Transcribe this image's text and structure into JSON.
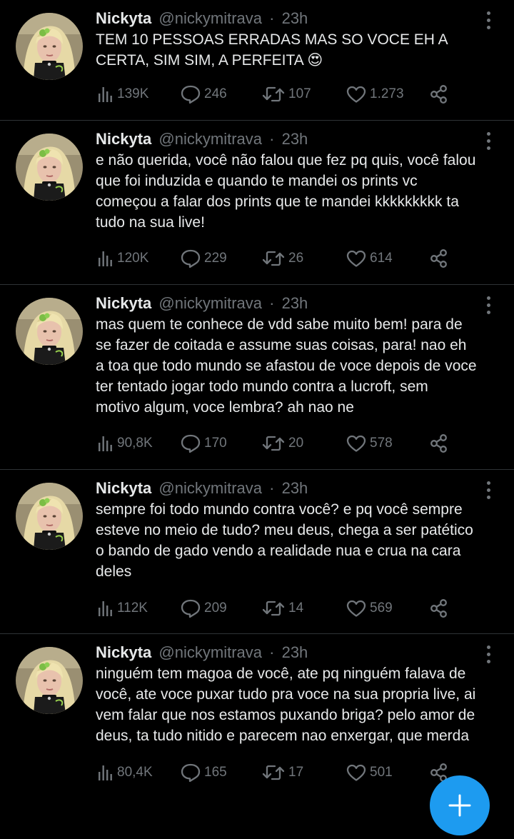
{
  "tweets": [
    {
      "name": "Nickyta",
      "handle": "@nickymitrava",
      "separator": "·",
      "time": "23h",
      "text": "TEM 10 PESSOAS ERRADAS MAS SO VOCE EH A\nCERTA, SIM SIM, A PERFEITA 😍",
      "views": "139K",
      "replies": "246",
      "retweets": "107",
      "likes": "1.273"
    },
    {
      "name": "Nickyta",
      "handle": "@nickymitrava",
      "separator": "·",
      "time": "23h",
      "text": "e não querida, você não falou que fez pq quis, você falou\nque foi induzida e quando te mandei os prints vc\ncomeçou a falar dos prints que te mandei kkkkkkkkk ta\ntudo na sua live!",
      "views": "120K",
      "replies": "229",
      "retweets": "26",
      "likes": "614"
    },
    {
      "name": "Nickyta",
      "handle": "@nickymitrava",
      "separator": "·",
      "time": "23h",
      "text": "mas quem te conhece de vdd sabe muito bem! para de\nse fazer de coitada e assume suas coisas, para! nao eh\na toa que todo mundo se afastou de voce depois de voce\nter tentado jogar todo mundo contra a lucroft, sem\nmotivo algum, voce lembra? ah nao ne",
      "views": "90,8K",
      "replies": "170",
      "retweets": "20",
      "likes": "578"
    },
    {
      "name": "Nickyta",
      "handle": "@nickymitrava",
      "separator": "·",
      "time": "23h",
      "text": "sempre foi todo mundo contra você? e pq você sempre\nesteve no meio de tudo? meu deus, chega a ser patético\no bando de gado vendo a realidade nua e crua na cara\ndeles",
      "views": "112K",
      "replies": "209",
      "retweets": "14",
      "likes": "569"
    },
    {
      "name": "Nickyta",
      "handle": "@nickymitrava",
      "separator": "·",
      "time": "23h",
      "text": "ninguém tem magoa de você, ate pq ninguém falava de\nvocê, ate voce puxar tudo pra voce na sua propria live, ai\nvem falar que nos estamos puxando briga? pelo amor de\ndeus, ta tudo nitido e parecem nao enxergar, que merda",
      "views": "80,4K",
      "replies": "165",
      "retweets": "17",
      "likes": "501"
    }
  ],
  "icons": {
    "views": "views-icon",
    "reply": "reply-icon",
    "retweet": "retweet-icon",
    "like": "heart-icon",
    "share": "share-icon",
    "more": "more-icon",
    "compose": "compose-icon"
  },
  "colors": {
    "background": "#000000",
    "text": "#e7e9ea",
    "secondary": "#71767b",
    "divider": "#2f3336",
    "accent": "#1d9bf0"
  }
}
